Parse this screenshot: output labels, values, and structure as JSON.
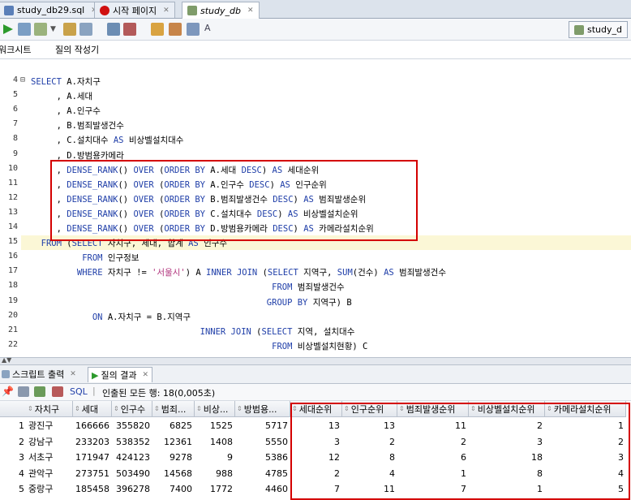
{
  "file_tabs": [
    {
      "label": "study_db29.sql",
      "active": false
    },
    {
      "label": "시작 페이지",
      "active": false
    },
    {
      "label": "study_db",
      "active": true
    }
  ],
  "connection": {
    "label": "study_d"
  },
  "editor_tabs": [
    {
      "label": "워크시트"
    },
    {
      "label": "질의 작성기"
    }
  ],
  "code_lines": [
    {
      "n": "4",
      "text": "SELECT A.자치구",
      "fold": "⊟"
    },
    {
      "n": "5",
      "text": "     , A.세대"
    },
    {
      "n": "6",
      "text": "     , A.인구수"
    },
    {
      "n": "7",
      "text": "     , B.범죄발생건수"
    },
    {
      "n": "8",
      "text": "     , C.설치대수 AS 비상벨설치대수"
    },
    {
      "n": "9",
      "text": "     , D.방범용카메라"
    },
    {
      "n": "10",
      "text": "     , DENSE_RANK() OVER (ORDER BY A.세대 DESC) AS 세대순위"
    },
    {
      "n": "11",
      "text": "     , DENSE_RANK() OVER (ORDER BY A.인구수 DESC) AS 인구순위"
    },
    {
      "n": "12",
      "text": "     , DENSE_RANK() OVER (ORDER BY B.범죄발생건수 DESC) AS 범죄발생순위"
    },
    {
      "n": "13",
      "text": "     , DENSE_RANK() OVER (ORDER BY C.설치대수 DESC) AS 비상벨설치순위"
    },
    {
      "n": "14",
      "text": "     , DENSE_RANK() OVER (ORDER BY D.방범용카메라 DESC) AS 카메라설치순위"
    },
    {
      "n": "15",
      "text": "  FROM (SELECT 자치구, 세대, 합계 AS 인구수",
      "highlight": true
    },
    {
      "n": "16",
      "text": "          FROM 인구정보"
    },
    {
      "n": "17",
      "text": "         WHERE 자치구 != '서울시') A INNER JOIN (SELECT 지역구, SUM(건수) AS 범죄발생건수"
    },
    {
      "n": "18",
      "text": "                                               FROM 범죄발생건수"
    },
    {
      "n": "19",
      "text": "                                              GROUP BY 지역구) B"
    },
    {
      "n": "20",
      "text": "            ON A.자치구 = B.지역구"
    },
    {
      "n": "21",
      "text": "                                 INNER JOIN (SELECT 지역, 설치대수"
    },
    {
      "n": "22",
      "text": "                                               FROM 비상벨설치현황) C"
    }
  ],
  "bottom_tabs": [
    {
      "label": "스크립트 출력"
    },
    {
      "label": "질의 결과"
    }
  ],
  "result_toolbar": {
    "sql_label": "SQL",
    "status": "인출된 모든 행: 18(0,005초)"
  },
  "grid": {
    "columns": [
      "자치구",
      "세대",
      "인구수",
      "범죄...",
      "비상...",
      "방범용...",
      "세대순위",
      "인구순위",
      "범죄발생순위",
      "비상벨설치순위",
      "카메라설치순위"
    ],
    "rows": [
      [
        "1",
        "광진구",
        "166666",
        "355820",
        "6825",
        "1525",
        "5717",
        "13",
        "13",
        "11",
        "2",
        "1"
      ],
      [
        "2",
        "강남구",
        "233203",
        "538352",
        "12361",
        "1408",
        "5550",
        "3",
        "2",
        "2",
        "3",
        "2"
      ],
      [
        "3",
        "서초구",
        "171947",
        "424123",
        "9278",
        "9",
        "5386",
        "12",
        "8",
        "6",
        "18",
        "3"
      ],
      [
        "4",
        "관악구",
        "273751",
        "503490",
        "14568",
        "988",
        "4785",
        "2",
        "4",
        "1",
        "8",
        "4"
      ],
      [
        "5",
        "중랑구",
        "185458",
        "396278",
        "7400",
        "1772",
        "4460",
        "7",
        "11",
        "7",
        "1",
        "5"
      ]
    ]
  },
  "colors": {
    "accent": "#1f3ea8",
    "string": "#b0317b",
    "highlight_box": "#d40000",
    "current_line": "#fbf7d6"
  }
}
